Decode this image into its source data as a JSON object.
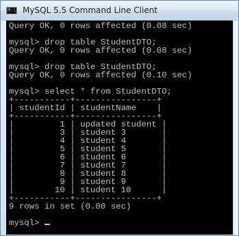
{
  "window": {
    "title": "MySQL 5.5 Command Line Client",
    "icon": "console-app-icon",
    "icon_text": "M:\\"
  },
  "console": {
    "lines": [
      "Query OK, 0 rows affected (0.08 sec)",
      "",
      "mysql> drop table StudentDTO;",
      "Query OK, 0 rows affected (0.08 sec)",
      "",
      "mysql> drop table StudentDTO;",
      "Query OK, 0 rows affected (0.10 sec)",
      "",
      "mysql> select * from StudentDTO;",
      "+-----------+----------------+",
      "| studentId | studentName    |",
      "+-----------+----------------+",
      "|         1 | updated student |",
      "|         3 | student 3       |",
      "|         4 | student 4       |",
      "|         5 | student 5       |",
      "|         6 | student 6       |",
      "|         7 | student 7       |",
      "|         8 | student 8       |",
      "|         9 | student 9       |",
      "|        10 | student 10      |",
      "+-----------+----------------+",
      "9 rows in set (0.00 sec)",
      "",
      "mysql> "
    ]
  }
}
